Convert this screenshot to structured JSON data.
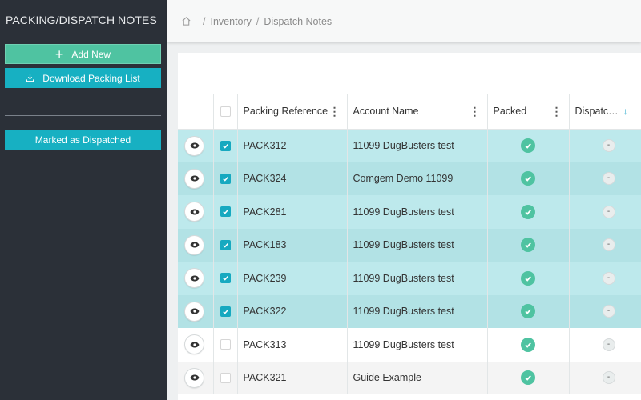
{
  "sidebar": {
    "title": "PACKING/DISPATCH NOTES",
    "add_new": "Add New",
    "download_packing_list": "Download Packing List",
    "marked_as_dispatched": "Marked as Dispatched"
  },
  "breadcrumb": {
    "home_icon": "home-icon",
    "items": [
      "Inventory",
      "Dispatch Notes"
    ],
    "separator": "/"
  },
  "table": {
    "columns": {
      "packing_reference": "Packing Reference",
      "account_name": "Account Name",
      "packed": "Packed",
      "dispatched": "Dispatc…"
    },
    "menu_glyph": "⋮",
    "sort_glyph": "↓",
    "dash_glyph": "-",
    "rows": [
      {
        "reference": "PACK312",
        "account": "11099 DugBusters test",
        "selected": true,
        "packed": true,
        "dispatched": false
      },
      {
        "reference": "PACK324",
        "account": "Comgem Demo 11099",
        "selected": true,
        "packed": true,
        "dispatched": false
      },
      {
        "reference": "PACK281",
        "account": "11099 DugBusters test",
        "selected": true,
        "packed": true,
        "dispatched": false
      },
      {
        "reference": "PACK183",
        "account": "11099 DugBusters test",
        "selected": true,
        "packed": true,
        "dispatched": false
      },
      {
        "reference": "PACK239",
        "account": "11099 DugBusters test",
        "selected": true,
        "packed": true,
        "dispatched": false
      },
      {
        "reference": "PACK322",
        "account": "11099 DugBusters test",
        "selected": true,
        "packed": true,
        "dispatched": false
      },
      {
        "reference": "PACK313",
        "account": "11099 DugBusters test",
        "selected": false,
        "packed": true,
        "dispatched": false
      },
      {
        "reference": "PACK321",
        "account": "Guide Example",
        "selected": false,
        "packed": true,
        "dispatched": false
      }
    ]
  },
  "colors": {
    "sidebar_bg": "#2b3038",
    "add_button": "#4fc3a1",
    "primary_button": "#17b0c2",
    "selected_row": "#bde9ec",
    "packed_badge": "#4fc3a1"
  }
}
